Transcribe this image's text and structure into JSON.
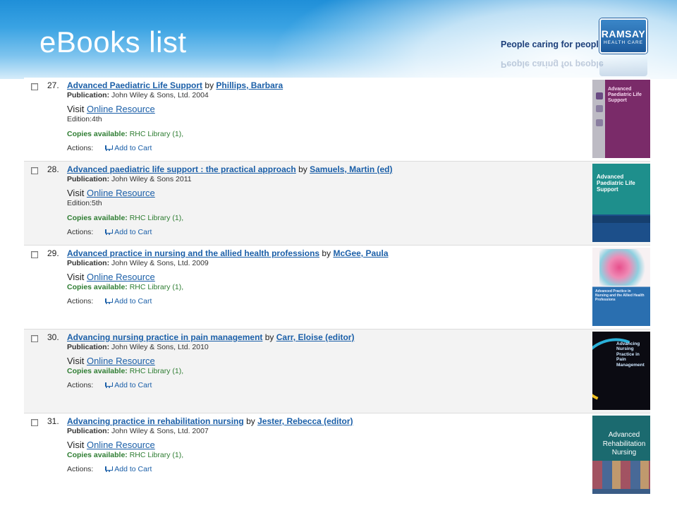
{
  "header": {
    "title": "eBooks list",
    "tagline": "People caring for people",
    "logo_line1": "RAMSAY",
    "logo_line2": "HEALTH CARE"
  },
  "common": {
    "by": "by",
    "publication_label": "Publication:",
    "edition_label": "Edition:",
    "visit_label": "Visit",
    "online_resource": "Online Resource",
    "copies_label": "Copies available:",
    "copies_value": "RHC Library (1),",
    "actions_label": "Actions:",
    "add_to_cart": "Add to Cart"
  },
  "results": [
    {
      "number": "27.",
      "title": "Advanced Paediatric Life Support",
      "author": "Phillips, Barbara",
      "publication": "John Wiley & Sons, Ltd. 2004",
      "edition": "4th",
      "cover_text": "Advanced Paediatric Life Support"
    },
    {
      "number": "28.",
      "title": "Advanced paediatric life support : the practical approach",
      "author": "Samuels, Martin (ed)",
      "publication": "John Wiley & Sons 2011",
      "edition": "5th",
      "cover_text": "Advanced Paediatric Life Support"
    },
    {
      "number": "29.",
      "title": "Advanced practice in nursing and the allied health professions",
      "author": "McGee, Paula",
      "publication": "John Wiley & Sons, Ltd. 2009",
      "edition": "",
      "cover_text": "Advanced Practice in Nursing and the Allied Health Professions"
    },
    {
      "number": "30.",
      "title": "Advancing nursing practice in pain management",
      "author": "Carr, Eloise (editor)",
      "publication": "John Wiley & Sons, Ltd. 2010",
      "edition": "",
      "cover_text": "Advancing Nursing Practice in Pain Management"
    },
    {
      "number": "31.",
      "title": "Advancing practice in rehabilitation nursing",
      "author": "Jester, Rebecca (editor)",
      "publication": "John Wiley & Sons, Ltd. 2007",
      "edition": "",
      "cover_text": "Advanced Rehabilitation Nursing"
    }
  ]
}
